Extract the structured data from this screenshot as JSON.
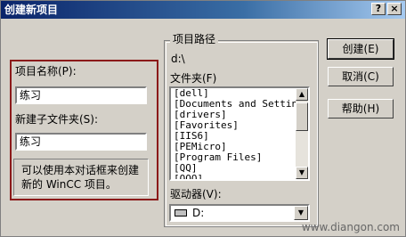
{
  "window": {
    "title": "创建新项目",
    "help_button": "?",
    "close_button": "×"
  },
  "left": {
    "project_name_label": "项目名称(P):",
    "project_name_value": "练习",
    "subfolder_label": "新建子文件夹(S):",
    "subfolder_value": "练习",
    "info_text": "可以使用本对话框来创建新的 WinCC 项目。"
  },
  "right": {
    "group_label": "项目路径",
    "current_path": "d:\\",
    "folder_label": "文件夹(F)",
    "folders": [
      "[dell]",
      "[Documents and Settings]",
      "[drivers]",
      "[Favorites]",
      "[IIS6]",
      "[PEMicro]",
      "[Program Files]",
      "[QQ]",
      "[QQQ]"
    ],
    "drive_label": "驱动器(V):",
    "drive_value": "D:"
  },
  "buttons": {
    "create": "创建(E)",
    "cancel": "取消(C)",
    "help": "帮助(H)"
  },
  "watermark": "www.diangon.com"
}
